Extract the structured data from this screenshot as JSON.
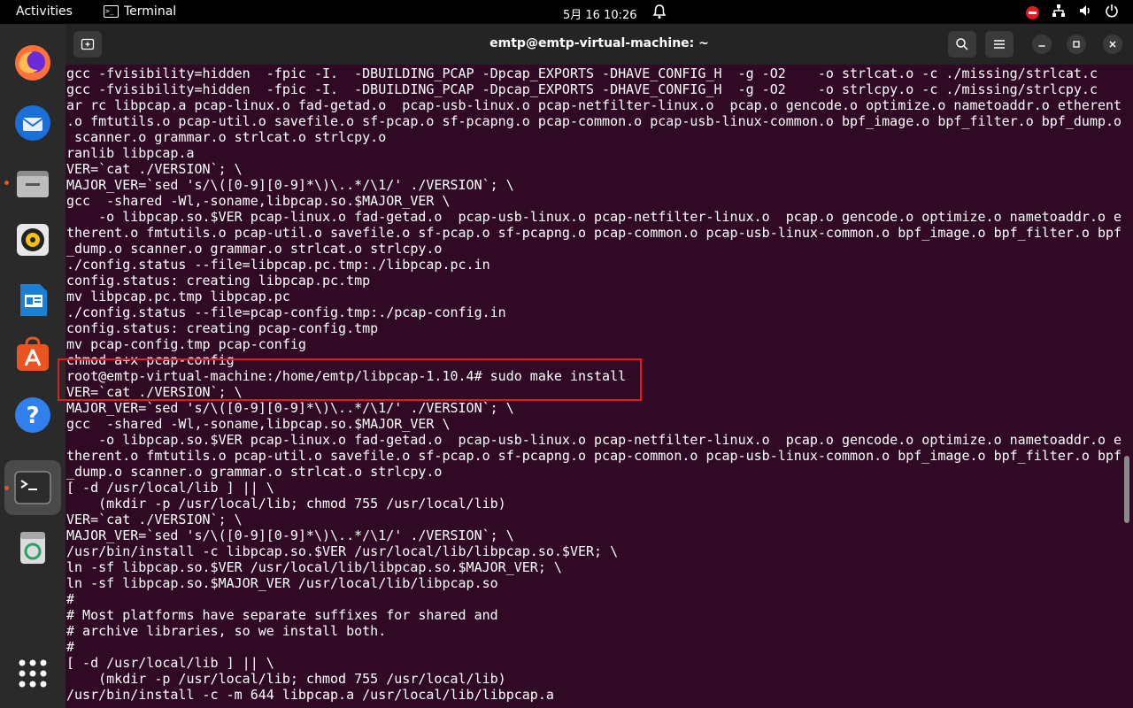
{
  "topbar": {
    "activities": "Activities",
    "app_name": "Terminal",
    "clock": "5月 16  10:26"
  },
  "dock": {
    "apps": [
      "firefox-icon",
      "thunderbird-icon",
      "files-icon",
      "rhythmbox-icon",
      "writer-icon",
      "app-center-icon",
      "help-icon",
      "terminal-icon",
      "trash-icon",
      "show-apps-icon"
    ]
  },
  "window": {
    "title": "emtp@emtp-virtual-machine: ~"
  },
  "terminal": {
    "lines": [
      "gcc -fvisibility=hidden  -fpic -I.  -DBUILDING_PCAP -Dpcap_EXPORTS -DHAVE_CONFIG_H  -g -O2    -o strlcat.o -c ./missing/strlcat.c",
      "gcc -fvisibility=hidden  -fpic -I.  -DBUILDING_PCAP -Dpcap_EXPORTS -DHAVE_CONFIG_H  -g -O2    -o strlcpy.o -c ./missing/strlcpy.c",
      "ar rc libpcap.a pcap-linux.o fad-getad.o  pcap-usb-linux.o pcap-netfilter-linux.o  pcap.o gencode.o optimize.o nametoaddr.o etherent",
      ".o fmtutils.o pcap-util.o savefile.o sf-pcap.o sf-pcapng.o pcap-common.o pcap-usb-linux-common.o bpf_image.o bpf_filter.o bpf_dump.o",
      " scanner.o grammar.o strlcat.o strlcpy.o",
      "ranlib libpcap.a",
      "VER=`cat ./VERSION`; \\",
      "MAJOR_VER=`sed 's/\\([0-9][0-9]*\\)\\..*/\\1/' ./VERSION`; \\",
      "gcc  -shared -Wl,-soname,libpcap.so.$MAJOR_VER \\",
      "    -o libpcap.so.$VER pcap-linux.o fad-getad.o  pcap-usb-linux.o pcap-netfilter-linux.o  pcap.o gencode.o optimize.o nametoaddr.o e",
      "therent.o fmtutils.o pcap-util.o savefile.o sf-pcap.o sf-pcapng.o pcap-common.o pcap-usb-linux-common.o bpf_image.o bpf_filter.o bpf",
      "_dump.o scanner.o grammar.o strlcat.o strlcpy.o",
      "./config.status --file=libpcap.pc.tmp:./libpcap.pc.in",
      "config.status: creating libpcap.pc.tmp",
      "mv libpcap.pc.tmp libpcap.pc",
      "./config.status --file=pcap-config.tmp:./pcap-config.in",
      "config.status: creating pcap-config.tmp",
      "mv pcap-config.tmp pcap-config",
      "chmod a+x pcap-config",
      "root@emtp-virtual-machine:/home/emtp/libpcap-1.10.4# sudo make install",
      "VER=`cat ./VERSION`; \\",
      "MAJOR_VER=`sed 's/\\([0-9][0-9]*\\)\\..*/\\1/' ./VERSION`; \\",
      "gcc  -shared -Wl,-soname,libpcap.so.$MAJOR_VER \\",
      "    -o libpcap.so.$VER pcap-linux.o fad-getad.o  pcap-usb-linux.o pcap-netfilter-linux.o  pcap.o gencode.o optimize.o nametoaddr.o e",
      "therent.o fmtutils.o pcap-util.o savefile.o sf-pcap.o sf-pcapng.o pcap-common.o pcap-usb-linux-common.o bpf_image.o bpf_filter.o bpf",
      "_dump.o scanner.o grammar.o strlcat.o strlcpy.o",
      "[ -d /usr/local/lib ] || \\",
      "    (mkdir -p /usr/local/lib; chmod 755 /usr/local/lib)",
      "VER=`cat ./VERSION`; \\",
      "MAJOR_VER=`sed 's/\\([0-9][0-9]*\\)\\..*/\\1/' ./VERSION`; \\",
      "/usr/bin/install -c libpcap.so.$VER /usr/local/lib/libpcap.so.$VER; \\",
      "ln -sf libpcap.so.$VER /usr/local/lib/libpcap.so.$MAJOR_VER; \\",
      "ln -sf libpcap.so.$MAJOR_VER /usr/local/lib/libpcap.so",
      "#",
      "# Most platforms have separate suffixes for shared and",
      "# archive libraries, so we install both.",
      "#",
      "[ -d /usr/local/lib ] || \\",
      "    (mkdir -p /usr/local/lib; chmod 755 /usr/local/lib)",
      "/usr/bin/install -c -m 644 libpcap.a /usr/local/lib/libpcap.a"
    ]
  }
}
